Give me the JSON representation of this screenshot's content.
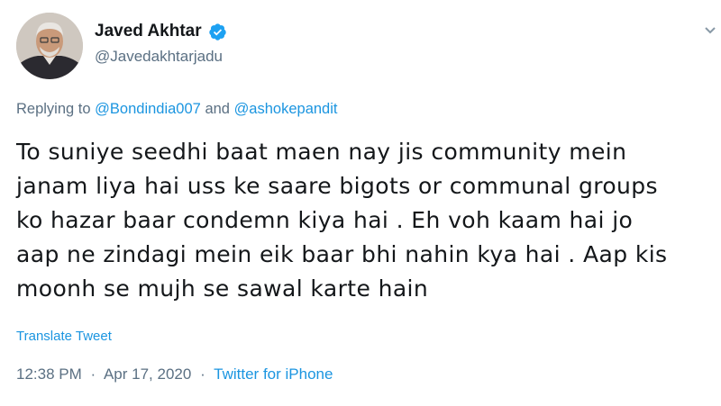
{
  "user": {
    "display_name": "Javed Akhtar",
    "handle": "@Javedakhtarjadu",
    "verified_icon": "verified-badge-icon",
    "avatar_icon": "profile-photo"
  },
  "more_icon": "chevron-down-icon",
  "replying": {
    "prefix": "Replying to",
    "mention1": "@Bondindia007",
    "conjunction": "and",
    "mention2": "@ashokepandit"
  },
  "tweet_lines": [
    "To suniye seedhi baat maen nay jis community mein",
    "janam liya hai uss ke saare bigots or communal groups",
    "ko hazar baar condemn kiya hai . Eh voh kaam hai jo",
    "aap ne zindagi mein eik baar bhi nahin kya hai . Aap kis",
    "moonh se mujh se sawal karte hain"
  ],
  "translate_label": "Translate Tweet",
  "meta": {
    "time": "12:38 PM",
    "separator": "·",
    "date": "Apr 17, 2020",
    "source": "Twitter for iPhone"
  },
  "colors": {
    "link": "#1b95e0",
    "secondary": "#5b7083",
    "text": "#14171a"
  }
}
